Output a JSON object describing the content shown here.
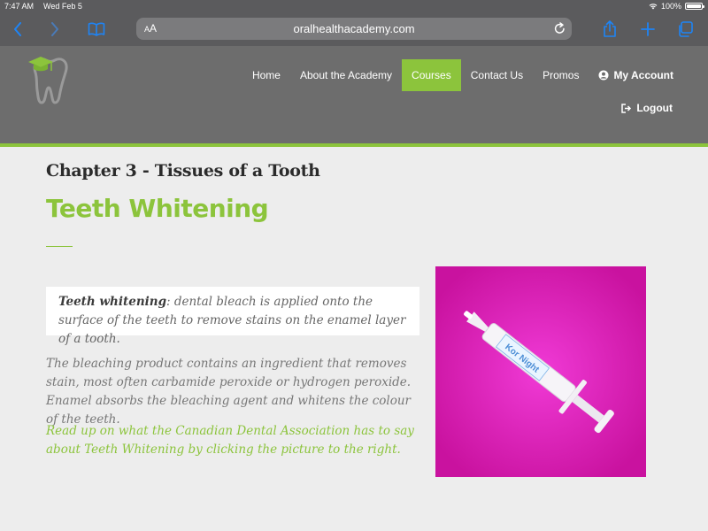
{
  "status_bar": {
    "time": "7:47 AM",
    "date": "Wed Feb 5",
    "battery": "100%"
  },
  "browser": {
    "text_size_label_small": "A",
    "text_size_label_large": "A",
    "url": "oralhealthacademy.com"
  },
  "nav": {
    "items": [
      {
        "label": "Home",
        "active": false
      },
      {
        "label": "About the Academy",
        "active": false
      },
      {
        "label": "Courses",
        "active": true
      },
      {
        "label": "Contact Us",
        "active": false
      },
      {
        "label": "Promos",
        "active": false
      }
    ],
    "account_label": "My Account",
    "logout_label": "Logout"
  },
  "content": {
    "chapter": "Chapter 3 - Tissues of a Tooth",
    "title": "Teeth Whitening",
    "callout_term": "Teeth whitening",
    "callout_text": ": dental bleach is applied onto the surface of the teeth to remove stains on the enamel layer of a tooth.",
    "paragraph": "The bleaching product contains an ingredient that removes stain, most often carbamide peroxide or hydrogen peroxide. Enamel absorbs the bleaching agent and whitens the colour of the teeth.",
    "link_text": "Read up on what the Canadian Dental Association has to say about Teeth Whitening by clicking the picture to the right.",
    "syringe_label": "Kor Night"
  },
  "colors": {
    "accent": "#8cc43c",
    "header": "#6d6d6d",
    "browser_chrome": "#5b5b5d",
    "ios_blue": "#1e84f5",
    "photo_bg": "#e01ac3"
  }
}
